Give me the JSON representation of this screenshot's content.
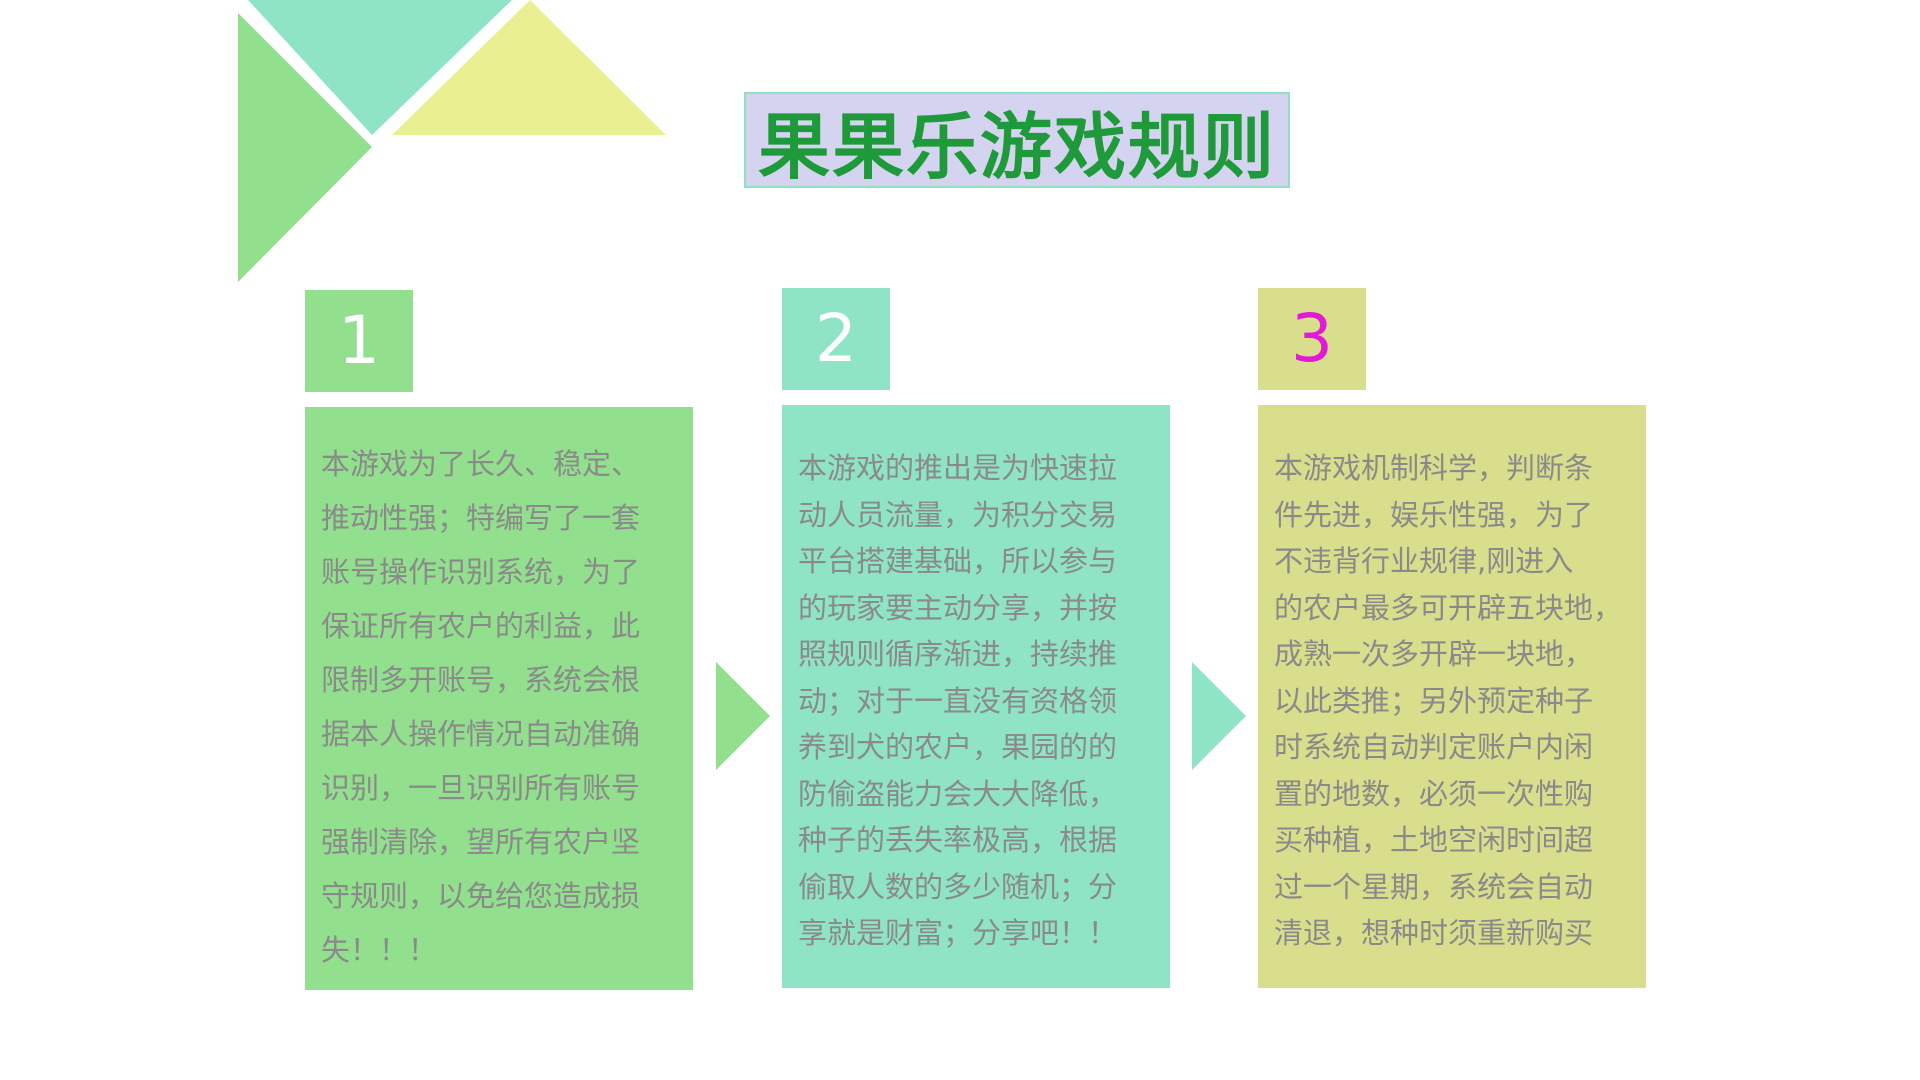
{
  "title": "果果乐游戏规则",
  "colors": {
    "green": "#92df8e",
    "teal": "#8fe4c5",
    "khaki": "#d9de8c",
    "yellow": "#e9f092",
    "title_bg": "#d4d4f0",
    "title_text": "#1f9a3a",
    "body_text": "#8a8a8a",
    "number_3": "#e21ad8"
  },
  "decoration_icons": [
    "triangle-left",
    "triangle-top",
    "triangle-yellow",
    "arrow-right-green",
    "arrow-right-teal"
  ],
  "steps": [
    {
      "number": "1",
      "lines": [
        "本游戏为了长久、稳定、",
        "推动性强；特编写了一套",
        "账号操作识别系统，为了",
        "保证所有农户的利益，此",
        "限制多开账号，系统会根",
        "据本人操作情况自动准确",
        "识别，一旦识别所有账号",
        "强制清除，望所有农户坚",
        "守规则，以免给您造成损",
        "失！！！"
      ]
    },
    {
      "number": "2",
      "lines": [
        "本游戏的推出是为快速拉",
        "动人员流量，为积分交易",
        "平台搭建基础，所以参与",
        "的玩家要主动分享，并按",
        "照规则循序渐进，持续推",
        "动；对于一直没有资格领",
        "养到犬的农户，果园的的",
        "防偷盗能力会大大降低，",
        "种子的丢失率极高，根据",
        "偷取人数的多少随机；分",
        "享就是财富；分享吧！！"
      ]
    },
    {
      "number": "3",
      "lines": [
        "本游戏机制科学，判断条",
        "件先进，娱乐性强，为了",
        "不违背行业规律,刚进入",
        "的农户最多可开辟五块地，",
        "成熟一次多开辟一块地，",
        "以此类推；另外预定种子",
        "时系统自动判定账户内闲",
        "置的地数，必须一次性购",
        "买种植，土地空闲时间超",
        "过一个星期，系统会自动",
        "清退，想种时须重新购买"
      ]
    }
  ]
}
